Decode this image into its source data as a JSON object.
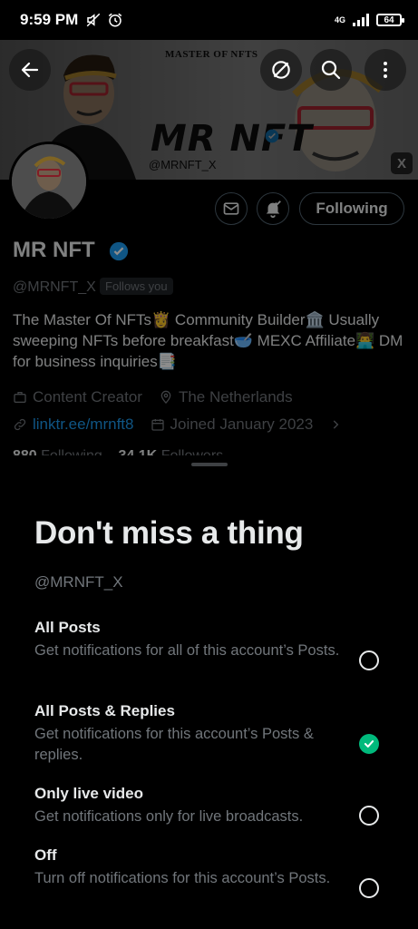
{
  "status_bar": {
    "time": "9:59 PM",
    "network": "4G",
    "battery": "64"
  },
  "banner": {
    "top_text": "MASTER OF NFTS",
    "title": "MR NFT",
    "handle": "@MRNFT_X",
    "corner_badge": "X"
  },
  "profile": {
    "following_label": "Following",
    "name": "MR NFT",
    "handle": "@MRNFT_X",
    "follows_you": "Follows you",
    "bio": "The Master Of NFTs👸 Community Builder🏛️ Usually sweeping NFTs before breakfast🥣 MEXC Affiliate👨‍💻 DM for business inquiries📑",
    "category": "Content Creator",
    "location": "The Netherlands",
    "link": "linktr.ee/mrnft8",
    "joined": "Joined January 2023",
    "following_count": "880",
    "following_word": "Following",
    "followers_count": "34.1K",
    "followers_word": "Followers"
  },
  "sheet": {
    "title": "Don't miss a thing",
    "handle": "@MRNFT_X",
    "options": [
      {
        "title": "All Posts",
        "desc": "Get notifications for all of this account’s Posts.",
        "selected": false
      },
      {
        "title": "All Posts & Replies",
        "desc": "Get notifications for this account’s Posts & replies.",
        "selected": true
      },
      {
        "title": "Only live video",
        "desc": "Get notifications only for live broadcasts.",
        "selected": false
      },
      {
        "title": "Off",
        "desc": "Turn off notifications for this account’s Posts.",
        "selected": false
      }
    ]
  },
  "colors": {
    "accent_blue": "#1d9bf0",
    "selected_green": "#00ba7c",
    "secondary_text": "#71767b"
  }
}
